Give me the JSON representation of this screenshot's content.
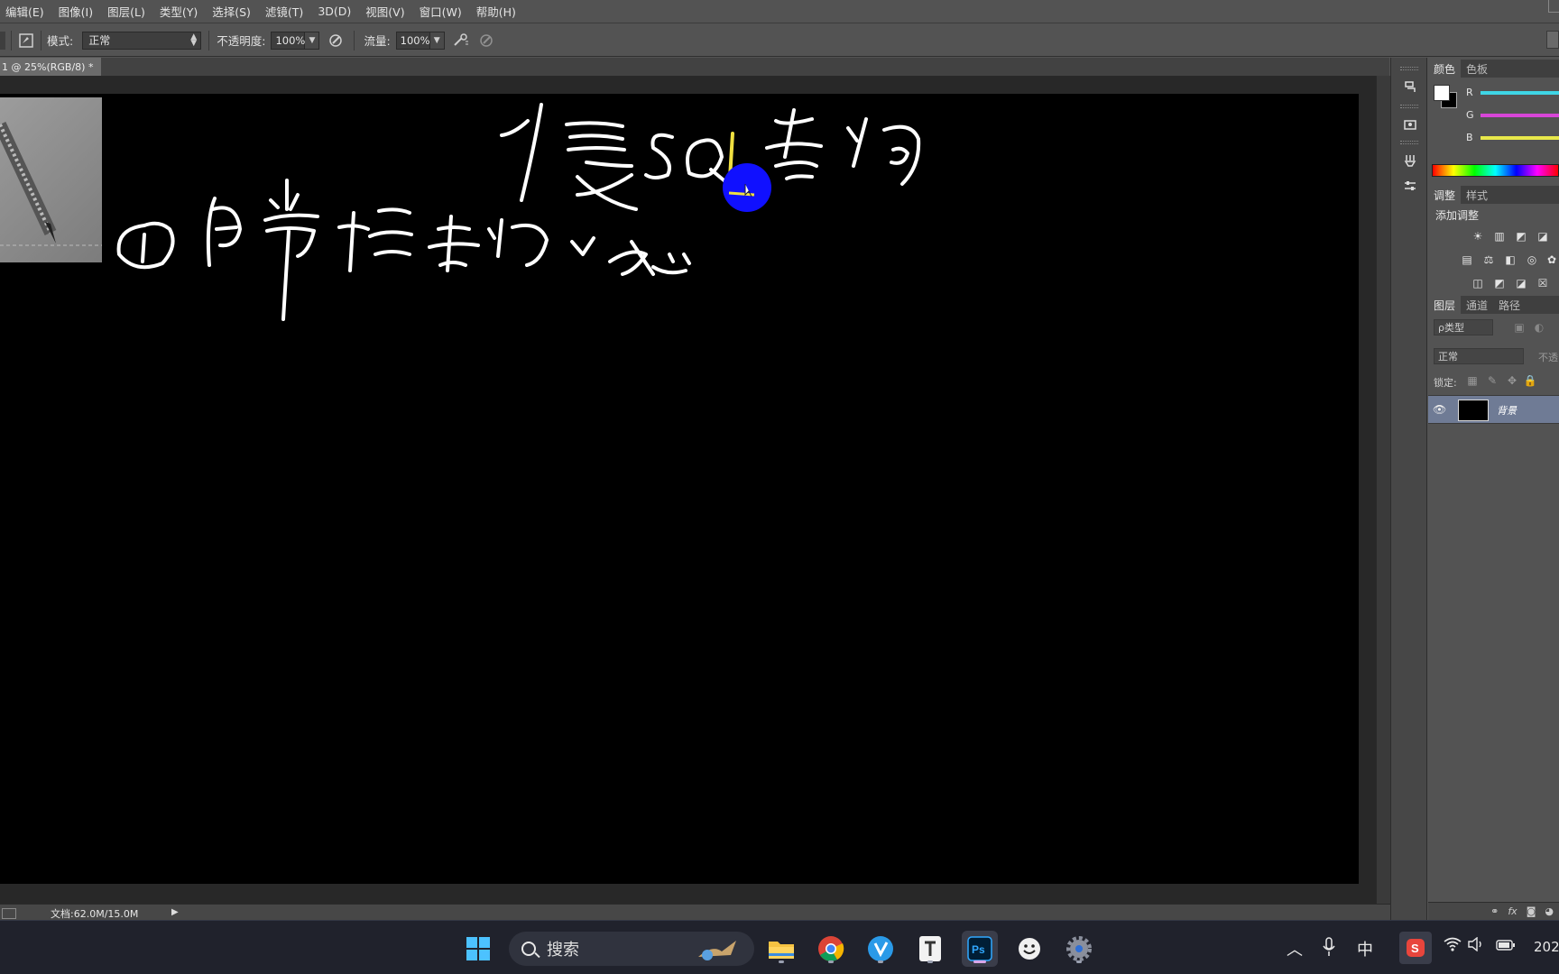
{
  "menu": {
    "items": [
      "编辑(E)",
      "图像(I)",
      "图层(L)",
      "类型(Y)",
      "选择(S)",
      "滤镜(T)",
      "3D(D)",
      "视图(V)",
      "窗口(W)",
      "帮助(H)"
    ]
  },
  "options": {
    "mode_label": "模式:",
    "mode_value": "正常",
    "opacity_label": "不透明度:",
    "opacity_value": "100%",
    "flow_label": "流量:",
    "flow_value": "100%"
  },
  "document": {
    "tab_title": "1 @ 25%(RGB/8) *",
    "close_glyph": "×",
    "status": "文档:62.0M/15.0M",
    "canvas_background": "#000000",
    "handwriting_top": "慢SQL查询",
    "handwriting_line1": "①日常排查问题"
  },
  "right_panel": {
    "color_tabs": [
      "颜色",
      "色板"
    ],
    "channels": [
      {
        "label": "R",
        "color": "#3fd6e6"
      },
      {
        "label": "G",
        "color": "#d846d8"
      },
      {
        "label": "B",
        "color": "#e8e84a"
      }
    ],
    "adjust_tabs": [
      "调整",
      "样式"
    ],
    "add_adjustment": "添加调整",
    "layer_tabs": [
      "图层",
      "通道",
      "路径"
    ],
    "filter_kind": "ρ类型",
    "blend_mode": "正常",
    "opacity_short": "不透",
    "lock_label": "锁定:",
    "layer_name": "背景",
    "selected_layer_color": "#6f7b95"
  },
  "taskbar": {
    "search_placeholder": "搜索",
    "ime_label": "中",
    "clock_partial": "202",
    "apps": [
      "start-icon",
      "file-explorer-icon",
      "chrome-icon",
      "vscode-like-icon",
      "typora-icon",
      "photoshop-icon",
      "emoji-icon",
      "settings-icon"
    ]
  }
}
